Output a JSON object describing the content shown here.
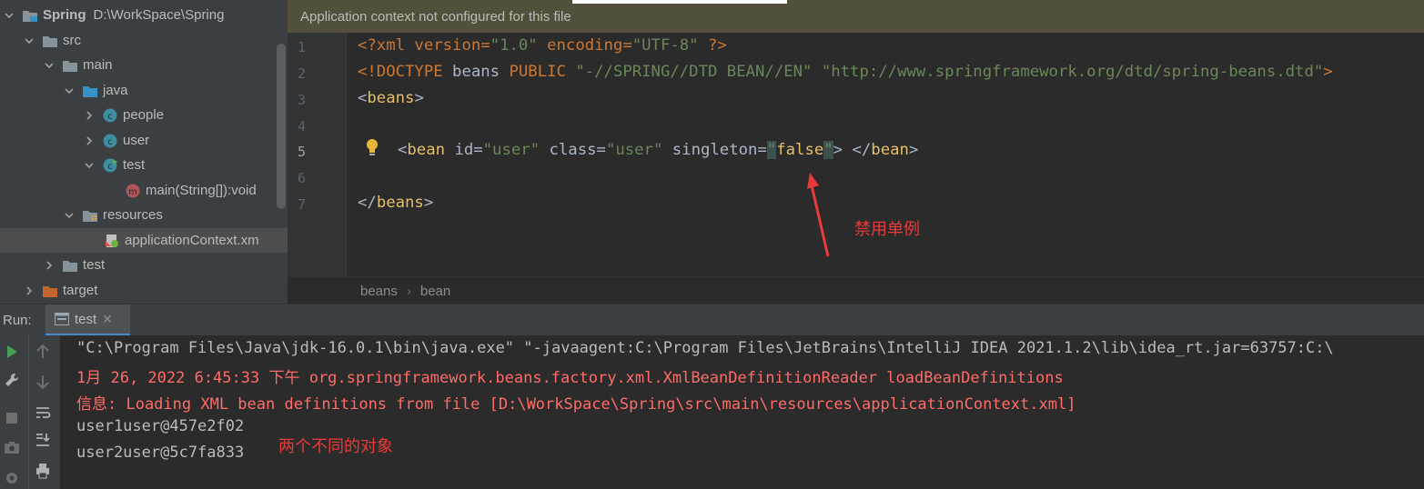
{
  "project_tree": {
    "items": [
      {
        "label": "Spring",
        "extra": "D:\\WorkSpace\\Spring",
        "icon": "module-icon",
        "expanded": true
      },
      {
        "label": "src",
        "icon": "folder-icon",
        "expanded": true
      },
      {
        "label": "main",
        "icon": "folder-icon",
        "expanded": true
      },
      {
        "label": "java",
        "icon": "source-folder-icon",
        "expanded": true
      },
      {
        "label": "people",
        "icon": "class-icon",
        "expanded": false
      },
      {
        "label": "user",
        "icon": "class-icon",
        "expanded": false
      },
      {
        "label": "test",
        "icon": "runnable-class-icon",
        "expanded": true
      },
      {
        "label": "main(String[]):void",
        "icon": "method-icon"
      },
      {
        "label": "resources",
        "icon": "resources-folder-icon",
        "expanded": true
      },
      {
        "label": "applicationContext.xm",
        "icon": "spring-xml-icon",
        "selected": true
      },
      {
        "label": "test",
        "icon": "folder-icon",
        "expanded": false
      },
      {
        "label": "target",
        "icon": "excluded-folder-icon",
        "expanded": false
      }
    ]
  },
  "editor": {
    "banner": "Application context not configured for this file",
    "line_numbers": [
      "1",
      "2",
      "3",
      "4",
      "5",
      "6",
      "7"
    ],
    "active_line": "5",
    "code": {
      "l1_a": "<?xml version=",
      "l1_b": "\"1.0\"",
      "l1_c": " encoding=",
      "l1_d": "\"UTF-8\"",
      "l1_e": " ?>",
      "l2_a": "<!DOCTYPE ",
      "l2_b": "beans ",
      "l2_c": "PUBLIC ",
      "l2_d": "\"-//SPRING//DTD BEAN//EN\"",
      "l2_e": " ",
      "l2_f": "\"http://www.springframework.org/dtd/spring-beans.dtd\"",
      "l2_g": ">",
      "l3_a": "<",
      "l3_b": "beans",
      "l3_c": ">",
      "l5_a": "<",
      "l5_b": "bean ",
      "l5_c": "id=",
      "l5_d": "\"user\"",
      "l5_e": " class=",
      "l5_f": "\"user\"",
      "l5_g": " singleton=",
      "l5_h1": "\"",
      "l5_h2": "false",
      "l5_h3": "\"",
      "l5_i": "> </",
      "l5_j": "bean",
      "l5_k": ">",
      "l7_a": "</",
      "l7_b": "beans",
      "l7_c": ">"
    },
    "breadcrumb": [
      "beans",
      "bean"
    ],
    "annotation": "禁用单例"
  },
  "run_panel": {
    "label": "Run:",
    "tab_label": "test",
    "console_lines": [
      {
        "text": "\"C:\\Program Files\\Java\\jdk-16.0.1\\bin\\java.exe\" \"-javaagent:C:\\Program Files\\JetBrains\\IntelliJ IDEA 2021.1.2\\lib\\idea_rt.jar=63757:C:\\",
        "color": "#bbbbbb"
      },
      {
        "text": "1月 26, 2022 6:45:33 下午 org.springframework.beans.factory.xml.XmlBeanDefinitionReader loadBeanDefinitions",
        "color": "#ff6b68"
      },
      {
        "text": "信息: Loading XML bean definitions from file [D:\\WorkSpace\\Spring\\src\\main\\resources\\applicationContext.xml]",
        "color": "#ff6b68"
      },
      {
        "text": "user1user@457e2f02",
        "color": "#bbbbbb"
      },
      {
        "text": "user2user@5c7fa833",
        "color": "#bbbbbb"
      }
    ],
    "annotation": "两个不同的对象"
  },
  "colors": {
    "banner_bg": "#52503a",
    "annotation_red": "#e83a3a",
    "console_error": "#ff6b68",
    "run_green": "#499c54"
  }
}
